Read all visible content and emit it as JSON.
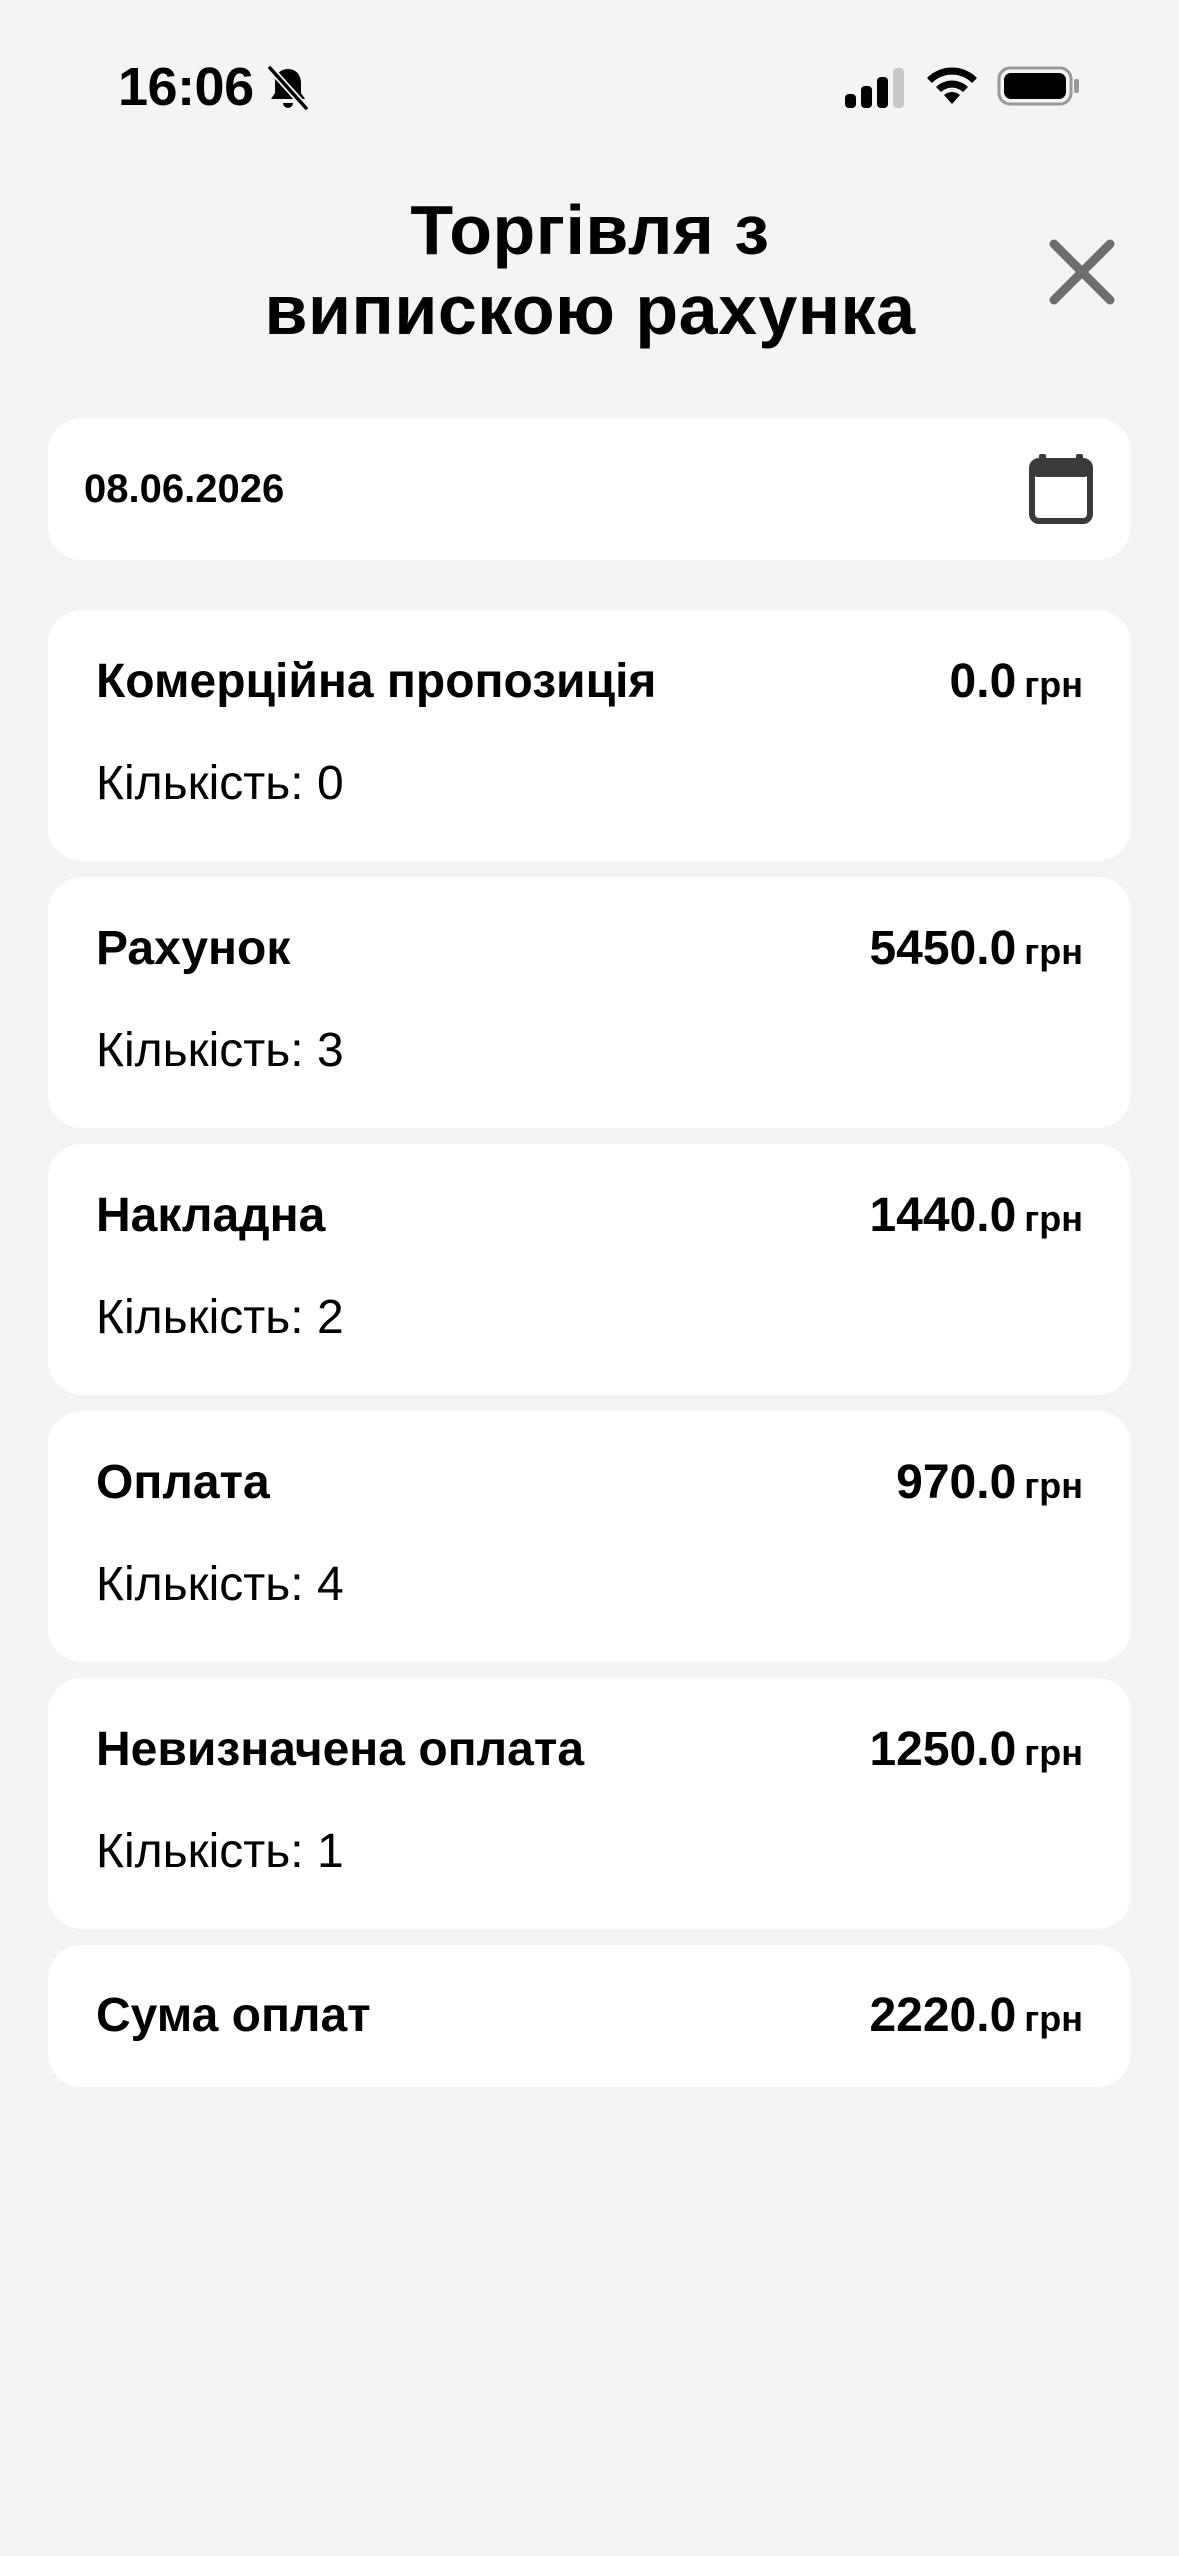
{
  "status_bar": {
    "time": "16:06",
    "icons": [
      "bell-slash-icon",
      "cellular-signal-icon",
      "wifi-icon",
      "battery-icon"
    ]
  },
  "header": {
    "title_line1": "Торгівля з",
    "title_line2": "випискою рахунка",
    "close_icon": "close-icon"
  },
  "date_field": {
    "value": "08.06.2026",
    "icon": "calendar-icon"
  },
  "currency": "грн",
  "cards": [
    {
      "title": "Комерційна пропозиція",
      "amount": "0.0",
      "currency": "грн",
      "qty": "Кількість: 0"
    },
    {
      "title": "Рахунок",
      "amount": "5450.0",
      "currency": "грн",
      "qty": "Кількість: 3"
    },
    {
      "title": "Накладна",
      "amount": "1440.0",
      "currency": "грн",
      "qty": "Кількість: 2"
    },
    {
      "title": "Оплата",
      "amount": "970.0",
      "currency": "грн",
      "qty": "Кількість: 4"
    },
    {
      "title": "Невизначена оплата",
      "amount": "1250.0",
      "currency": "грн",
      "qty": "Кількість: 1"
    }
  ],
  "total": {
    "title": "Сума оплат",
    "amount": "2220.0",
    "currency": "грн"
  },
  "colors": {
    "background": "#f4f4f4",
    "card": "#ffffff",
    "text": "#000000",
    "icon_gray": "#6e6e6e",
    "calendar": "#3a3a3a"
  }
}
